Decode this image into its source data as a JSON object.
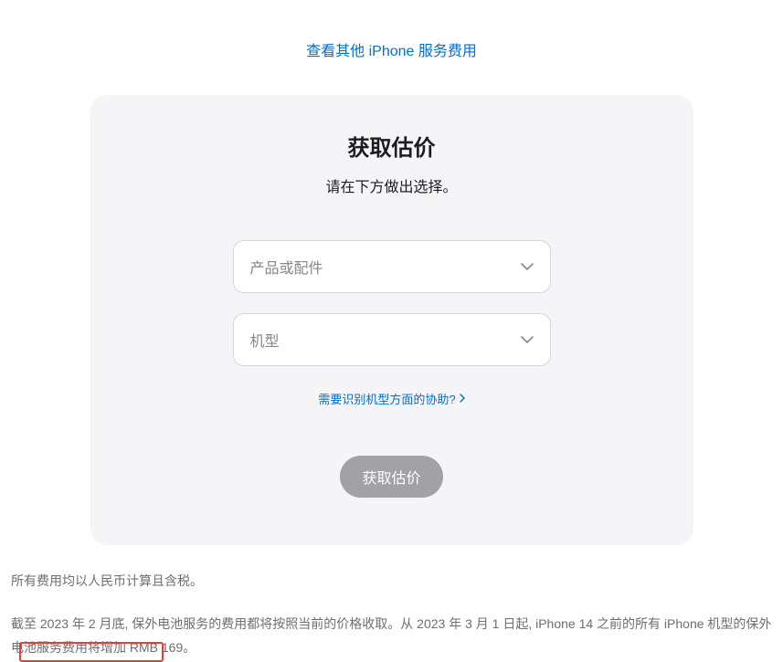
{
  "topLink": "查看其他 iPhone 服务费用",
  "card": {
    "title": "获取估价",
    "subtitle": "请在下方做出选择。",
    "select1": "产品或配件",
    "select2": "机型",
    "helpLink": "需要识别机型方面的协助?",
    "button": "获取估价"
  },
  "footer": {
    "line1": "所有费用均以人民币计算且含税。",
    "line2_part1": "截至 2023 年 2 月底, 保外电池服务的费用都将按照当前的价格收取。从 2023 年 3 月 1 日起, iPhone 14 之前的所有 iPhone 机型的保外电池服务",
    "line2_part2": "费用将增加 RMB 169。"
  }
}
